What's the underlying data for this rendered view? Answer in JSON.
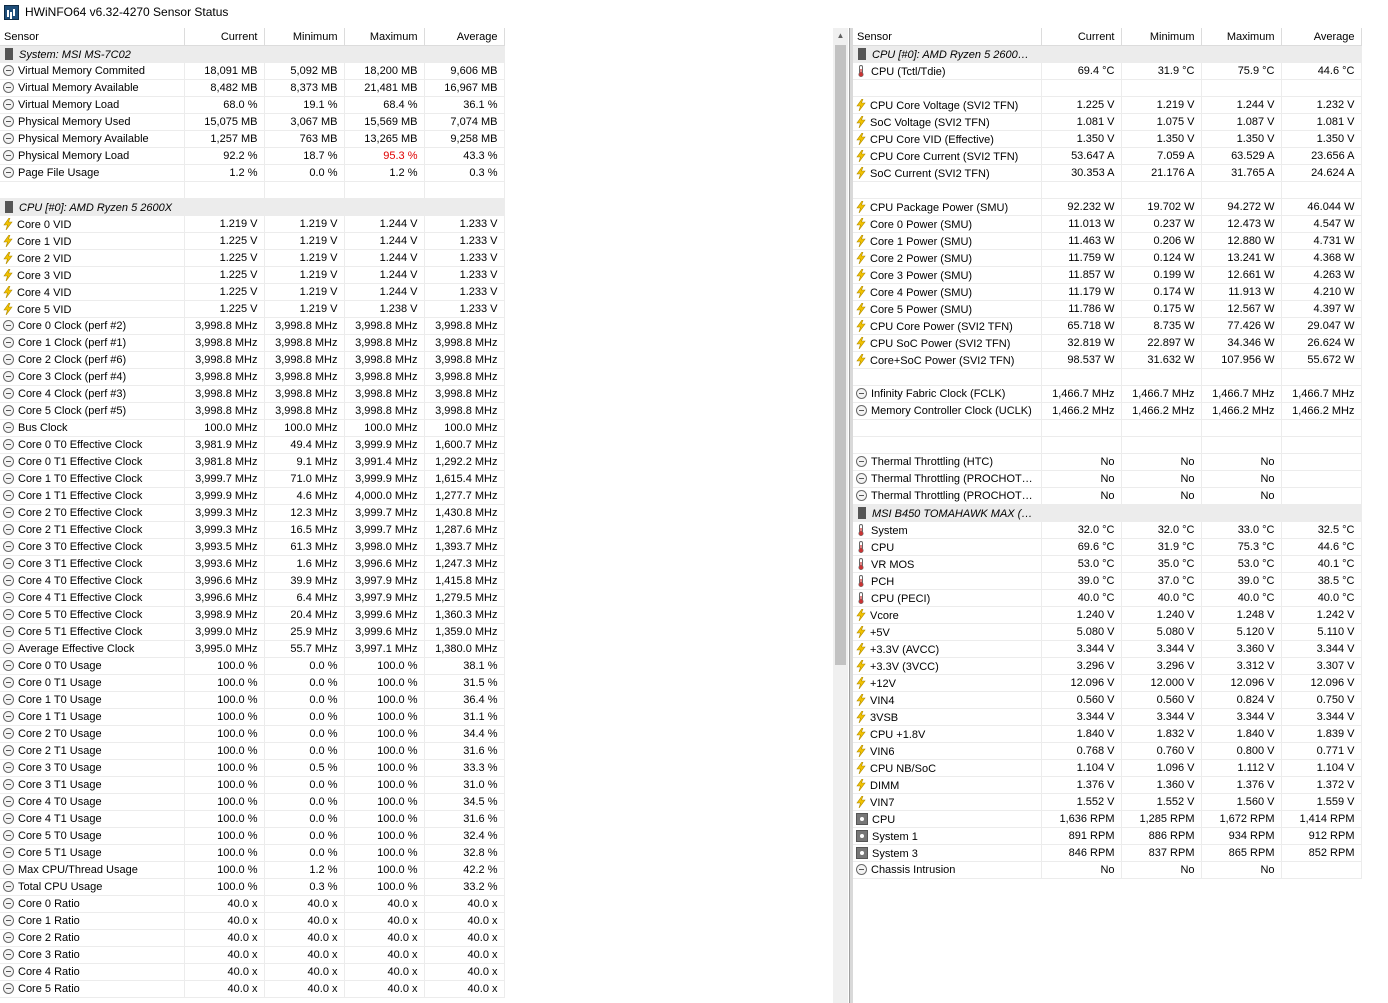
{
  "window": {
    "title": "HWiNFO64 v6.32-4270 Sensor Status"
  },
  "columns": [
    "Sensor",
    "Current",
    "Minimum",
    "Maximum",
    "Average"
  ],
  "left": [
    {
      "type": "group",
      "icon": "chip",
      "name": "System: MSI MS-7C02"
    },
    {
      "icon": "circle",
      "name": "Virtual Memory Commited",
      "cur": "18,091 MB",
      "min": "5,092 MB",
      "max": "18,200 MB",
      "avg": "9,606 MB"
    },
    {
      "icon": "circle",
      "name": "Virtual Memory Available",
      "cur": "8,482 MB",
      "min": "8,373 MB",
      "max": "21,481 MB",
      "avg": "16,967 MB"
    },
    {
      "icon": "circle",
      "name": "Virtual Memory Load",
      "cur": "68.0 %",
      "min": "19.1 %",
      "max": "68.4 %",
      "avg": "36.1 %"
    },
    {
      "icon": "circle",
      "name": "Physical Memory Used",
      "cur": "15,075 MB",
      "min": "3,067 MB",
      "max": "15,569 MB",
      "avg": "7,074 MB"
    },
    {
      "icon": "circle",
      "name": "Physical Memory Available",
      "cur": "1,257 MB",
      "min": "763 MB",
      "max": "13,265 MB",
      "avg": "9,258 MB"
    },
    {
      "icon": "circle",
      "name": "Physical Memory Load",
      "cur": "92.2 %",
      "min": "18.7 %",
      "max": "95.3 %",
      "avg": "43.3 %",
      "maxRed": true
    },
    {
      "icon": "circle",
      "name": "Page File Usage",
      "cur": "1.2 %",
      "min": "0.0 %",
      "max": "1.2 %",
      "avg": "0.3 %"
    },
    {
      "type": "blank"
    },
    {
      "type": "group",
      "icon": "chip",
      "name": "CPU [#0]: AMD Ryzen 5 2600X"
    },
    {
      "icon": "bolt",
      "name": "Core 0 VID",
      "cur": "1.219 V",
      "min": "1.219 V",
      "max": "1.244 V",
      "avg": "1.233 V"
    },
    {
      "icon": "bolt",
      "name": "Core 1 VID",
      "cur": "1.225 V",
      "min": "1.219 V",
      "max": "1.244 V",
      "avg": "1.233 V"
    },
    {
      "icon": "bolt",
      "name": "Core 2 VID",
      "cur": "1.225 V",
      "min": "1.219 V",
      "max": "1.244 V",
      "avg": "1.233 V"
    },
    {
      "icon": "bolt",
      "name": "Core 3 VID",
      "cur": "1.225 V",
      "min": "1.219 V",
      "max": "1.244 V",
      "avg": "1.233 V"
    },
    {
      "icon": "bolt",
      "name": "Core 4 VID",
      "cur": "1.225 V",
      "min": "1.219 V",
      "max": "1.244 V",
      "avg": "1.233 V"
    },
    {
      "icon": "bolt",
      "name": "Core 5 VID",
      "cur": "1.225 V",
      "min": "1.219 V",
      "max": "1.238 V",
      "avg": "1.233 V"
    },
    {
      "icon": "circle",
      "name": "Core 0 Clock (perf #2)",
      "cur": "3,998.8 MHz",
      "min": "3,998.8 MHz",
      "max": "3,998.8 MHz",
      "avg": "3,998.8 MHz"
    },
    {
      "icon": "circle",
      "name": "Core 1 Clock (perf #1)",
      "cur": "3,998.8 MHz",
      "min": "3,998.8 MHz",
      "max": "3,998.8 MHz",
      "avg": "3,998.8 MHz"
    },
    {
      "icon": "circle",
      "name": "Core 2 Clock (perf #6)",
      "cur": "3,998.8 MHz",
      "min": "3,998.8 MHz",
      "max": "3,998.8 MHz",
      "avg": "3,998.8 MHz"
    },
    {
      "icon": "circle",
      "name": "Core 3 Clock (perf #4)",
      "cur": "3,998.8 MHz",
      "min": "3,998.8 MHz",
      "max": "3,998.8 MHz",
      "avg": "3,998.8 MHz"
    },
    {
      "icon": "circle",
      "name": "Core 4 Clock (perf #3)",
      "cur": "3,998.8 MHz",
      "min": "3,998.8 MHz",
      "max": "3,998.8 MHz",
      "avg": "3,998.8 MHz"
    },
    {
      "icon": "circle",
      "name": "Core 5 Clock (perf #5)",
      "cur": "3,998.8 MHz",
      "min": "3,998.8 MHz",
      "max": "3,998.8 MHz",
      "avg": "3,998.8 MHz"
    },
    {
      "icon": "circle",
      "name": "Bus Clock",
      "cur": "100.0 MHz",
      "min": "100.0 MHz",
      "max": "100.0 MHz",
      "avg": "100.0 MHz"
    },
    {
      "icon": "circle",
      "name": "Core 0 T0 Effective Clock",
      "cur": "3,981.9 MHz",
      "min": "49.4 MHz",
      "max": "3,999.9 MHz",
      "avg": "1,600.7 MHz"
    },
    {
      "icon": "circle",
      "name": "Core 0 T1 Effective Clock",
      "cur": "3,981.8 MHz",
      "min": "9.1 MHz",
      "max": "3,991.4 MHz",
      "avg": "1,292.2 MHz"
    },
    {
      "icon": "circle",
      "name": "Core 1 T0 Effective Clock",
      "cur": "3,999.7 MHz",
      "min": "71.0 MHz",
      "max": "3,999.9 MHz",
      "avg": "1,615.4 MHz"
    },
    {
      "icon": "circle",
      "name": "Core 1 T1 Effective Clock",
      "cur": "3,999.9 MHz",
      "min": "4.6 MHz",
      "max": "4,000.0 MHz",
      "avg": "1,277.7 MHz"
    },
    {
      "icon": "circle",
      "name": "Core 2 T0 Effective Clock",
      "cur": "3,999.3 MHz",
      "min": "12.3 MHz",
      "max": "3,999.7 MHz",
      "avg": "1,430.8 MHz"
    },
    {
      "icon": "circle",
      "name": "Core 2 T1 Effective Clock",
      "cur": "3,999.3 MHz",
      "min": "16.5 MHz",
      "max": "3,999.7 MHz",
      "avg": "1,287.6 MHz"
    },
    {
      "icon": "circle",
      "name": "Core 3 T0 Effective Clock",
      "cur": "3,993.5 MHz",
      "min": "61.3 MHz",
      "max": "3,998.0 MHz",
      "avg": "1,393.7 MHz"
    },
    {
      "icon": "circle",
      "name": "Core 3 T1 Effective Clock",
      "cur": "3,993.6 MHz",
      "min": "1.6 MHz",
      "max": "3,996.6 MHz",
      "avg": "1,247.3 MHz"
    },
    {
      "icon": "circle",
      "name": "Core 4 T0 Effective Clock",
      "cur": "3,996.6 MHz",
      "min": "39.9 MHz",
      "max": "3,997.9 MHz",
      "avg": "1,415.8 MHz"
    },
    {
      "icon": "circle",
      "name": "Core 4 T1 Effective Clock",
      "cur": "3,996.6 MHz",
      "min": "6.4 MHz",
      "max": "3,997.9 MHz",
      "avg": "1,279.5 MHz"
    },
    {
      "icon": "circle",
      "name": "Core 5 T0 Effective Clock",
      "cur": "3,998.9 MHz",
      "min": "20.4 MHz",
      "max": "3,999.6 MHz",
      "avg": "1,360.3 MHz"
    },
    {
      "icon": "circle",
      "name": "Core 5 T1 Effective Clock",
      "cur": "3,999.0 MHz",
      "min": "25.9 MHz",
      "max": "3,999.6 MHz",
      "avg": "1,359.0 MHz"
    },
    {
      "icon": "circle",
      "name": "Average Effective Clock",
      "cur": "3,995.0 MHz",
      "min": "55.7 MHz",
      "max": "3,997.1 MHz",
      "avg": "1,380.0 MHz"
    },
    {
      "icon": "circle",
      "name": "Core 0 T0 Usage",
      "cur": "100.0 %",
      "min": "0.0 %",
      "max": "100.0 %",
      "avg": "38.1 %"
    },
    {
      "icon": "circle",
      "name": "Core 0 T1 Usage",
      "cur": "100.0 %",
      "min": "0.0 %",
      "max": "100.0 %",
      "avg": "31.5 %"
    },
    {
      "icon": "circle",
      "name": "Core 1 T0 Usage",
      "cur": "100.0 %",
      "min": "0.0 %",
      "max": "100.0 %",
      "avg": "36.4 %"
    },
    {
      "icon": "circle",
      "name": "Core 1 T1 Usage",
      "cur": "100.0 %",
      "min": "0.0 %",
      "max": "100.0 %",
      "avg": "31.1 %"
    },
    {
      "icon": "circle",
      "name": "Core 2 T0 Usage",
      "cur": "100.0 %",
      "min": "0.0 %",
      "max": "100.0 %",
      "avg": "34.4 %"
    },
    {
      "icon": "circle",
      "name": "Core 2 T1 Usage",
      "cur": "100.0 %",
      "min": "0.0 %",
      "max": "100.0 %",
      "avg": "31.6 %"
    },
    {
      "icon": "circle",
      "name": "Core 3 T0 Usage",
      "cur": "100.0 %",
      "min": "0.5 %",
      "max": "100.0 %",
      "avg": "33.3 %"
    },
    {
      "icon": "circle",
      "name": "Core 3 T1 Usage",
      "cur": "100.0 %",
      "min": "0.0 %",
      "max": "100.0 %",
      "avg": "31.0 %"
    },
    {
      "icon": "circle",
      "name": "Core 4 T0 Usage",
      "cur": "100.0 %",
      "min": "0.0 %",
      "max": "100.0 %",
      "avg": "34.5 %"
    },
    {
      "icon": "circle",
      "name": "Core 4 T1 Usage",
      "cur": "100.0 %",
      "min": "0.0 %",
      "max": "100.0 %",
      "avg": "31.6 %"
    },
    {
      "icon": "circle",
      "name": "Core 5 T0 Usage",
      "cur": "100.0 %",
      "min": "0.0 %",
      "max": "100.0 %",
      "avg": "32.4 %"
    },
    {
      "icon": "circle",
      "name": "Core 5 T1 Usage",
      "cur": "100.0 %",
      "min": "0.0 %",
      "max": "100.0 %",
      "avg": "32.8 %"
    },
    {
      "icon": "circle",
      "name": "Max CPU/Thread Usage",
      "cur": "100.0 %",
      "min": "1.2 %",
      "max": "100.0 %",
      "avg": "42.2 %"
    },
    {
      "icon": "circle",
      "name": "Total CPU Usage",
      "cur": "100.0 %",
      "min": "0.3 %",
      "max": "100.0 %",
      "avg": "33.2 %"
    },
    {
      "icon": "circle",
      "name": "Core 0 Ratio",
      "cur": "40.0 x",
      "min": "40.0 x",
      "max": "40.0 x",
      "avg": "40.0 x"
    },
    {
      "icon": "circle",
      "name": "Core 1 Ratio",
      "cur": "40.0 x",
      "min": "40.0 x",
      "max": "40.0 x",
      "avg": "40.0 x"
    },
    {
      "icon": "circle",
      "name": "Core 2 Ratio",
      "cur": "40.0 x",
      "min": "40.0 x",
      "max": "40.0 x",
      "avg": "40.0 x"
    },
    {
      "icon": "circle",
      "name": "Core 3 Ratio",
      "cur": "40.0 x",
      "min": "40.0 x",
      "max": "40.0 x",
      "avg": "40.0 x"
    },
    {
      "icon": "circle",
      "name": "Core 4 Ratio",
      "cur": "40.0 x",
      "min": "40.0 x",
      "max": "40.0 x",
      "avg": "40.0 x"
    },
    {
      "icon": "circle",
      "name": "Core 5 Ratio",
      "cur": "40.0 x",
      "min": "40.0 x",
      "max": "40.0 x",
      "avg": "40.0 x"
    }
  ],
  "right": [
    {
      "type": "group",
      "icon": "chip",
      "name": "CPU [#0]: AMD Ryzen 5 2600X:..."
    },
    {
      "icon": "therm",
      "name": "CPU (Tctl/Tdie)",
      "cur": "69.4 °C",
      "min": "31.9 °C",
      "max": "75.9 °C",
      "avg": "44.6 °C"
    },
    {
      "type": "blank"
    },
    {
      "icon": "bolt",
      "name": "CPU Core Voltage (SVI2 TFN)",
      "cur": "1.225 V",
      "min": "1.219 V",
      "max": "1.244 V",
      "avg": "1.232 V"
    },
    {
      "icon": "bolt",
      "name": "SoC Voltage (SVI2 TFN)",
      "cur": "1.081 V",
      "min": "1.075 V",
      "max": "1.087 V",
      "avg": "1.081 V"
    },
    {
      "icon": "bolt",
      "name": "CPU Core VID (Effective)",
      "cur": "1.350 V",
      "min": "1.350 V",
      "max": "1.350 V",
      "avg": "1.350 V"
    },
    {
      "icon": "bolt",
      "name": "CPU Core Current (SVI2 TFN)",
      "cur": "53.647 A",
      "min": "7.059 A",
      "max": "63.529 A",
      "avg": "23.656 A"
    },
    {
      "icon": "bolt",
      "name": "SoC Current (SVI2 TFN)",
      "cur": "30.353 A",
      "min": "21.176 A",
      "max": "31.765 A",
      "avg": "24.624 A"
    },
    {
      "type": "blank"
    },
    {
      "icon": "bolt",
      "name": "CPU Package Power (SMU)",
      "cur": "92.232 W",
      "min": "19.702 W",
      "max": "94.272 W",
      "avg": "46.044 W"
    },
    {
      "icon": "bolt",
      "name": "Core 0 Power (SMU)",
      "cur": "11.013 W",
      "min": "0.237 W",
      "max": "12.473 W",
      "avg": "4.547 W"
    },
    {
      "icon": "bolt",
      "name": "Core 1 Power (SMU)",
      "cur": "11.463 W",
      "min": "0.206 W",
      "max": "12.880 W",
      "avg": "4.731 W"
    },
    {
      "icon": "bolt",
      "name": "Core 2 Power (SMU)",
      "cur": "11.759 W",
      "min": "0.124 W",
      "max": "13.241 W",
      "avg": "4.368 W"
    },
    {
      "icon": "bolt",
      "name": "Core 3 Power (SMU)",
      "cur": "11.857 W",
      "min": "0.199 W",
      "max": "12.661 W",
      "avg": "4.263 W"
    },
    {
      "icon": "bolt",
      "name": "Core 4 Power (SMU)",
      "cur": "11.179 W",
      "min": "0.174 W",
      "max": "11.913 W",
      "avg": "4.210 W"
    },
    {
      "icon": "bolt",
      "name": "Core 5 Power (SMU)",
      "cur": "11.786 W",
      "min": "0.175 W",
      "max": "12.567 W",
      "avg": "4.397 W"
    },
    {
      "icon": "bolt",
      "name": "CPU Core Power (SVI2 TFN)",
      "cur": "65.718 W",
      "min": "8.735 W",
      "max": "77.426 W",
      "avg": "29.047 W"
    },
    {
      "icon": "bolt",
      "name": "CPU SoC Power (SVI2 TFN)",
      "cur": "32.819 W",
      "min": "22.897 W",
      "max": "34.346 W",
      "avg": "26.624 W"
    },
    {
      "icon": "bolt",
      "name": "Core+SoC Power (SVI2 TFN)",
      "cur": "98.537 W",
      "min": "31.632 W",
      "max": "107.956 W",
      "avg": "55.672 W"
    },
    {
      "type": "blank"
    },
    {
      "icon": "circle",
      "name": "Infinity Fabric Clock (FCLK)",
      "cur": "1,466.7 MHz",
      "min": "1,466.7 MHz",
      "max": "1,466.7 MHz",
      "avg": "1,466.7 MHz"
    },
    {
      "icon": "circle",
      "name": "Memory Controller Clock (UCLK)",
      "cur": "1,466.2 MHz",
      "min": "1,466.2 MHz",
      "max": "1,466.2 MHz",
      "avg": "1,466.2 MHz"
    },
    {
      "type": "blank"
    },
    {
      "type": "blank"
    },
    {
      "icon": "circle",
      "name": "Thermal Throttling (HTC)",
      "cur": "No",
      "min": "No",
      "max": "No",
      "avg": ""
    },
    {
      "icon": "circle",
      "name": "Thermal Throttling (PROCHOT C...",
      "cur": "No",
      "min": "No",
      "max": "No",
      "avg": ""
    },
    {
      "icon": "circle",
      "name": "Thermal Throttling (PROCHOT E...",
      "cur": "No",
      "min": "No",
      "max": "No",
      "avg": ""
    },
    {
      "type": "group",
      "icon": "chip",
      "name": "MSI B450 TOMAHAWK MAX (MS..."
    },
    {
      "icon": "therm",
      "name": "System",
      "cur": "32.0 °C",
      "min": "32.0 °C",
      "max": "33.0 °C",
      "avg": "32.5 °C"
    },
    {
      "icon": "therm",
      "name": "CPU",
      "cur": "69.6 °C",
      "min": "31.9 °C",
      "max": "75.3 °C",
      "avg": "44.6 °C"
    },
    {
      "icon": "therm",
      "name": "VR MOS",
      "cur": "53.0 °C",
      "min": "35.0 °C",
      "max": "53.0 °C",
      "avg": "40.1 °C"
    },
    {
      "icon": "therm",
      "name": "PCH",
      "cur": "39.0 °C",
      "min": "37.0 °C",
      "max": "39.0 °C",
      "avg": "38.5 °C"
    },
    {
      "icon": "therm",
      "name": "CPU (PECI)",
      "cur": "40.0 °C",
      "min": "40.0 °C",
      "max": "40.0 °C",
      "avg": "40.0 °C"
    },
    {
      "icon": "bolt",
      "name": "Vcore",
      "cur": "1.240 V",
      "min": "1.240 V",
      "max": "1.248 V",
      "avg": "1.242 V"
    },
    {
      "icon": "bolt",
      "name": "+5V",
      "cur": "5.080 V",
      "min": "5.080 V",
      "max": "5.120 V",
      "avg": "5.110 V"
    },
    {
      "icon": "bolt",
      "name": "+3.3V (AVCC)",
      "cur": "3.344 V",
      "min": "3.344 V",
      "max": "3.360 V",
      "avg": "3.344 V"
    },
    {
      "icon": "bolt",
      "name": "+3.3V (3VCC)",
      "cur": "3.296 V",
      "min": "3.296 V",
      "max": "3.312 V",
      "avg": "3.307 V"
    },
    {
      "icon": "bolt",
      "name": "+12V",
      "cur": "12.096 V",
      "min": "12.000 V",
      "max": "12.096 V",
      "avg": "12.096 V"
    },
    {
      "icon": "bolt",
      "name": "VIN4",
      "cur": "0.560 V",
      "min": "0.560 V",
      "max": "0.824 V",
      "avg": "0.750 V"
    },
    {
      "icon": "bolt",
      "name": "3VSB",
      "cur": "3.344 V",
      "min": "3.344 V",
      "max": "3.344 V",
      "avg": "3.344 V"
    },
    {
      "icon": "bolt",
      "name": "CPU +1.8V",
      "cur": "1.840 V",
      "min": "1.832 V",
      "max": "1.840 V",
      "avg": "1.839 V"
    },
    {
      "icon": "bolt",
      "name": "VIN6",
      "cur": "0.768 V",
      "min": "0.760 V",
      "max": "0.800 V",
      "avg": "0.771 V"
    },
    {
      "icon": "bolt",
      "name": "CPU NB/SoC",
      "cur": "1.104 V",
      "min": "1.096 V",
      "max": "1.112 V",
      "avg": "1.104 V"
    },
    {
      "icon": "bolt",
      "name": "DIMM",
      "cur": "1.376 V",
      "min": "1.360 V",
      "max": "1.376 V",
      "avg": "1.372 V"
    },
    {
      "icon": "bolt",
      "name": "VIN7",
      "cur": "1.552 V",
      "min": "1.552 V",
      "max": "1.560 V",
      "avg": "1.559 V"
    },
    {
      "icon": "fan",
      "name": "CPU",
      "cur": "1,636 RPM",
      "min": "1,285 RPM",
      "max": "1,672 RPM",
      "avg": "1,414 RPM"
    },
    {
      "icon": "fan",
      "name": "System 1",
      "cur": "891 RPM",
      "min": "886 RPM",
      "max": "934 RPM",
      "avg": "912 RPM"
    },
    {
      "icon": "fan",
      "name": "System 3",
      "cur": "846 RPM",
      "min": "837 RPM",
      "max": "865 RPM",
      "avg": "852 RPM"
    },
    {
      "icon": "circle",
      "name": "Chassis Intrusion",
      "cur": "No",
      "min": "No",
      "max": "No",
      "avg": ""
    }
  ],
  "colors": {
    "group_bg": "#ececec",
    "alert": "#e00000",
    "bolt": "#f2c200"
  }
}
